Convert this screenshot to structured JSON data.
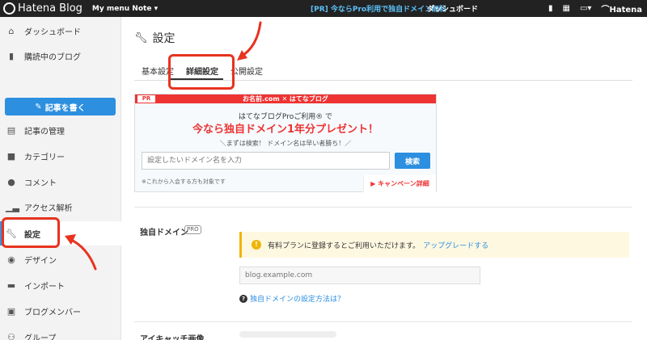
{
  "topbar": {
    "logo": "Hatena Blog",
    "menu_note": "My menu Note ▾",
    "pr_link": "[PR] 今ならPro利用で独自ドメイン無料",
    "dashboard": "ダッシュボード",
    "hatena": "Hatena"
  },
  "sidebar": {
    "items": [
      {
        "label": "ダッシュボード",
        "icon": "home-icon"
      },
      {
        "label": "購読中のブログ",
        "icon": "bookmark-icon"
      },
      {
        "label": "記事を書く",
        "icon": "edit-icon"
      },
      {
        "label": "記事の管理",
        "icon": "document-icon"
      },
      {
        "label": "カテゴリー",
        "icon": "folder-icon"
      },
      {
        "label": "コメント",
        "icon": "comment-icon"
      },
      {
        "label": "アクセス解析",
        "icon": "chart-icon"
      },
      {
        "label": "設定",
        "icon": "wrench-icon"
      },
      {
        "label": "デザイン",
        "icon": "palette-icon"
      },
      {
        "label": "インポート",
        "icon": "truck-icon"
      },
      {
        "label": "ブログメンバー",
        "icon": "members-icon"
      },
      {
        "label": "グループ",
        "icon": "group-icon"
      }
    ]
  },
  "main": {
    "title": "設定",
    "tabs": [
      {
        "label": "基本設定"
      },
      {
        "label": "詳細設定"
      },
      {
        "label": "公開設定"
      }
    ],
    "banner": {
      "pr": "PR",
      "head": "お名前.com ✕ はてなブログ",
      "line1": "はてなブログProご利用® で",
      "line2": "今なら独自ドメイン1年分プレゼント！",
      "line3": "＼まずは検索！ ドメイン名は早い者勝ち！／",
      "placeholder": "設定したいドメイン名を入力",
      "search": "検索",
      "note": "※これから入会する方も対象です",
      "campaign": "▶ キャンペーン詳細"
    },
    "custom_domain": {
      "label": "独自ドメイン",
      "pro": "PRO",
      "notice": "有料プランに登録するとご利用いただけます。",
      "upgrade": "アップグレードする",
      "placeholder": "blog.example.com",
      "help": "独自ドメインの設定方法は？"
    },
    "eyecatch": {
      "label": "アイキャッチ画像"
    }
  }
}
